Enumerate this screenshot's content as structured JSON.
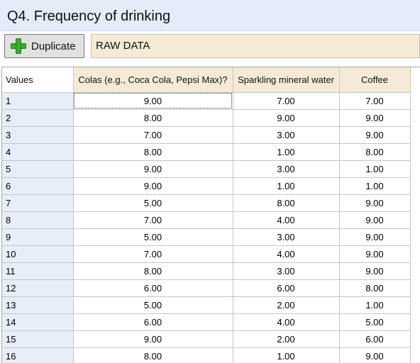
{
  "window": {
    "title": "Q4. Frequency of drinking"
  },
  "toolbar": {
    "duplicate_label": "Duplicate",
    "plus_icon": "plus-icon",
    "plus_color": "#3cae2e"
  },
  "data_label": "RAW DATA",
  "table": {
    "corner_label": "Values",
    "columns": [
      "Colas (e.g., Coca Cola, Pepsi Max)?",
      "Sparkling mineral water",
      "Coffee"
    ],
    "rows": [
      {
        "label": "1",
        "values": [
          "9.00",
          "7.00",
          "7.00"
        ]
      },
      {
        "label": "2",
        "values": [
          "8.00",
          "9.00",
          "9.00"
        ]
      },
      {
        "label": "3",
        "values": [
          "7.00",
          "3.00",
          "9.00"
        ]
      },
      {
        "label": "4",
        "values": [
          "8.00",
          "1.00",
          "8.00"
        ]
      },
      {
        "label": "5",
        "values": [
          "9.00",
          "3.00",
          "1.00"
        ]
      },
      {
        "label": "6",
        "values": [
          "9.00",
          "1.00",
          "1.00"
        ]
      },
      {
        "label": "7",
        "values": [
          "5.00",
          "8.00",
          "9.00"
        ]
      },
      {
        "label": "8",
        "values": [
          "7.00",
          "4.00",
          "9.00"
        ]
      },
      {
        "label": "9",
        "values": [
          "5.00",
          "3.00",
          "9.00"
        ]
      },
      {
        "label": "10",
        "values": [
          "7.00",
          "4.00",
          "9.00"
        ]
      },
      {
        "label": "11",
        "values": [
          "8.00",
          "3.00",
          "9.00"
        ]
      },
      {
        "label": "12",
        "values": [
          "6.00",
          "6.00",
          "8.00"
        ]
      },
      {
        "label": "13",
        "values": [
          "5.00",
          "2.00",
          "1.00"
        ]
      },
      {
        "label": "14",
        "values": [
          "6.00",
          "4.00",
          "5.00"
        ]
      },
      {
        "label": "15",
        "values": [
          "9.00",
          "2.00",
          "6.00"
        ]
      },
      {
        "label": "16",
        "values": [
          "8.00",
          "1.00",
          "9.00"
        ]
      }
    ]
  }
}
